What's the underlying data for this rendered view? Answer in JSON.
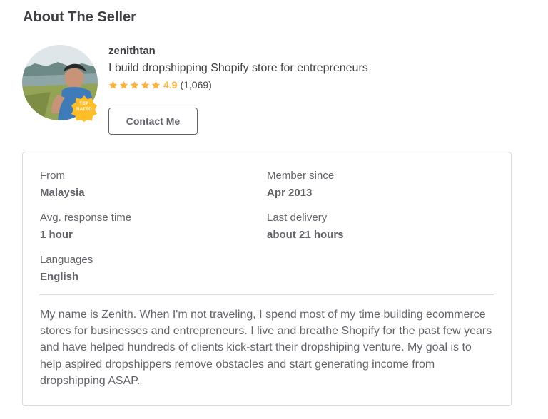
{
  "section": {
    "title": "About The Seller"
  },
  "seller": {
    "username": "zenithtan",
    "tagline": "I build dropshipping Shopify store for entrepreneurs",
    "rating": {
      "score": "4.9",
      "count": "(1,069)",
      "stars": 5
    },
    "badge": {
      "line1": "TOP",
      "line2": "RATED"
    },
    "contact_label": "Contact Me"
  },
  "stats": {
    "from": {
      "label": "From",
      "value": "Malaysia"
    },
    "member_since": {
      "label": "Member since",
      "value": "Apr 2013"
    },
    "response_time": {
      "label": "Avg. response time",
      "value": "1 hour"
    },
    "last_delivery": {
      "label": "Last delivery",
      "value": "about 21 hours"
    },
    "languages": {
      "label": "Languages",
      "value": "English"
    }
  },
  "description": "My name is Zenith. When I'm not traveling, I spend most of my time building ecommerce stores for businesses and entrepreneurs. I live and breathe Shopify for the past few years and have helped hundreds of clients kick-start their dropshiping venture. My goal is to help aspired dropshippers remove obstacles and start generating income from dropshipping ASAP.",
  "colors": {
    "star": "#ffb33e",
    "badge": "#ffbe26",
    "text_dark": "#404145",
    "text_muted": "#62646a",
    "border": "#dadbdd"
  },
  "icons": {
    "star": "star-icon",
    "badge": "top-rated-badge-icon"
  }
}
